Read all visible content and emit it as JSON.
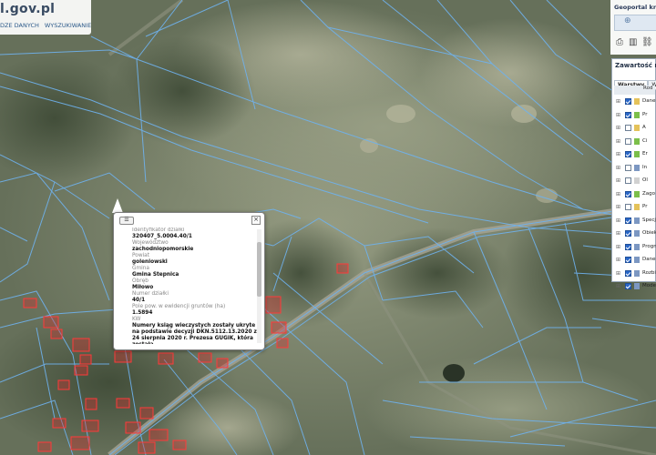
{
  "header": {
    "logo_text": "l.gov.pl",
    "tabs": [
      "DZE DANYCH",
      "WYSZUKIWANIE"
    ]
  },
  "geoportal": {
    "title": "Geoportal kr"
  },
  "layers_panel": {
    "title": "Zawartość ma",
    "tabs": [
      "Warstwy",
      "W"
    ],
    "column_header": "Rod",
    "layers": [
      {
        "label": "Dane",
        "checked": true,
        "expandable": true,
        "color": "#e4c25a"
      },
      {
        "label": "Pr",
        "checked": true,
        "expandable": true,
        "color": "#7cbf4a"
      },
      {
        "label": "A",
        "checked": false,
        "expandable": true,
        "color": "#e4c25a"
      },
      {
        "label": "Ci",
        "checked": false,
        "expandable": true,
        "color": "#7cbf4a"
      },
      {
        "label": "Er",
        "checked": true,
        "expandable": true,
        "color": "#7cbf4a"
      },
      {
        "label": "In",
        "checked": false,
        "expandable": true,
        "color": "#7c97c2"
      },
      {
        "label": "Ol",
        "checked": false,
        "expandable": true,
        "color": "#d1d1d1"
      },
      {
        "label": "Zago",
        "checked": true,
        "expandable": true,
        "color": "#7cbf4a"
      },
      {
        "label": "Pr",
        "checked": false,
        "expandable": true,
        "color": "#e4c25a"
      },
      {
        "label": "Specj",
        "checked": true,
        "expandable": true,
        "color": "#7c97c2"
      },
      {
        "label": "Obiek",
        "checked": true,
        "expandable": true,
        "color": "#7c97c2"
      },
      {
        "label": "Progno",
        "checked": true,
        "expandable": true,
        "color": "#7c97c2"
      },
      {
        "label": "Dane",
        "checked": true,
        "expandable": true,
        "color": "#7c97c2"
      },
      {
        "label": "Rozbi",
        "checked": true,
        "expandable": true,
        "color": "#7c97c2"
      },
      {
        "label": "Mode",
        "checked": true,
        "expandable": true,
        "color": "#7c97c2"
      }
    ]
  },
  "popup": {
    "fields": [
      {
        "key": "Identyfikator działki",
        "value": "320407_5.0004.40/1"
      },
      {
        "key": "Województwo",
        "value": "zachodniopomorskie"
      },
      {
        "key": "Powiat",
        "value": "goleniowski"
      },
      {
        "key": "Gmina",
        "value": "Gmina Stepnica"
      },
      {
        "key": "Obręb",
        "value": "Miłowo"
      },
      {
        "key": "Numer działki",
        "value": "40/1"
      },
      {
        "key": "Pole pow. w ewidencji gruntów (ha)",
        "value": "1.5894"
      },
      {
        "key": "KW",
        "value": "Numery ksiąg wieczystych zostały ukryte na podstawie decyzji DKN.5112.13.2020 z 24 sierpnia 2020 r. Prezesa GUGiK, która została"
      }
    ]
  },
  "colors": {
    "parcel_lines": "#6fb2ee",
    "building_fill": "#d92b2b",
    "map_base": "#5f6a52"
  }
}
